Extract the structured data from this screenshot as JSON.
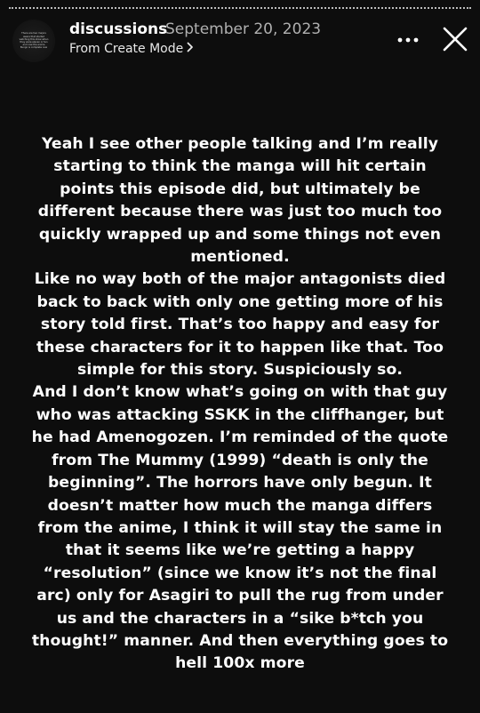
{
  "header": {
    "avatar_text": "There are two majors aware that started watching this show when they were eleven or ten and now the anime Bungo is complete now",
    "username": "discussions",
    "date": "September 20, 2023",
    "subline": "From Create Mode",
    "subline_icon": "chevron-right-icon",
    "more_icon": "more-horizontal-icon",
    "close_icon": "close-icon"
  },
  "story": {
    "paragraphs": [
      "Yeah I see other people talking and I’m really starting to think the manga will hit certain points this episode did, but ultimately be different because there was just too much too quickly wrapped up and some things not even mentioned.",
      "Like no way both of the major antagonists died back to back with only one getting more of his story told first. That’s too happy and easy for these characters for it to happen like that. Too simple for this story. Suspiciously so.",
      "And I don’t know what’s going on with that guy who was attacking SSKK in the cliffhanger, but he had Amenogozen. I’m reminded of the quote from The Mummy (1999) “death is only the beginning”. The horrors have only begun. It doesn’t matter how much the manga differs from the anime, I think it will stay the same in that it seems like we’re getting a happy “resolution” (since we know it’s not the final arc) only for Asagiri to pull the rug from under us and the characters in a “sike b*tch you thought!” manner. And then everything goes to hell 100x more"
    ]
  },
  "colors": {
    "background": "#0d0d0d",
    "text": "#ffffff",
    "secondary_text": "#b0b0b0"
  }
}
